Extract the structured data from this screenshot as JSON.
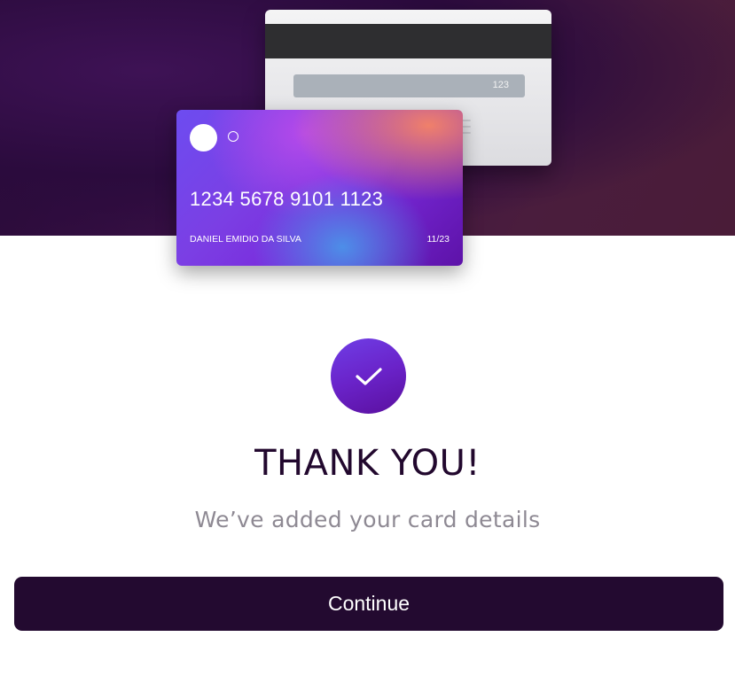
{
  "card_back": {
    "cvv": "123"
  },
  "card_front": {
    "number": "1234 5678 9101 1123",
    "holder_name": "DANIEL EMIDIO DA SILVA",
    "expiry": "11/23"
  },
  "success": {
    "icon": "checkmark-icon",
    "title": "THANK YOU!",
    "message": "We’ve added your card details"
  },
  "actions": {
    "continue_label": "Continue"
  },
  "colors": {
    "hero_background": "#2b0b3d",
    "accent": "#6a23c9",
    "button_background": "#230a30",
    "title_text": "#22082e",
    "subtitle_text": "#8e8993"
  }
}
